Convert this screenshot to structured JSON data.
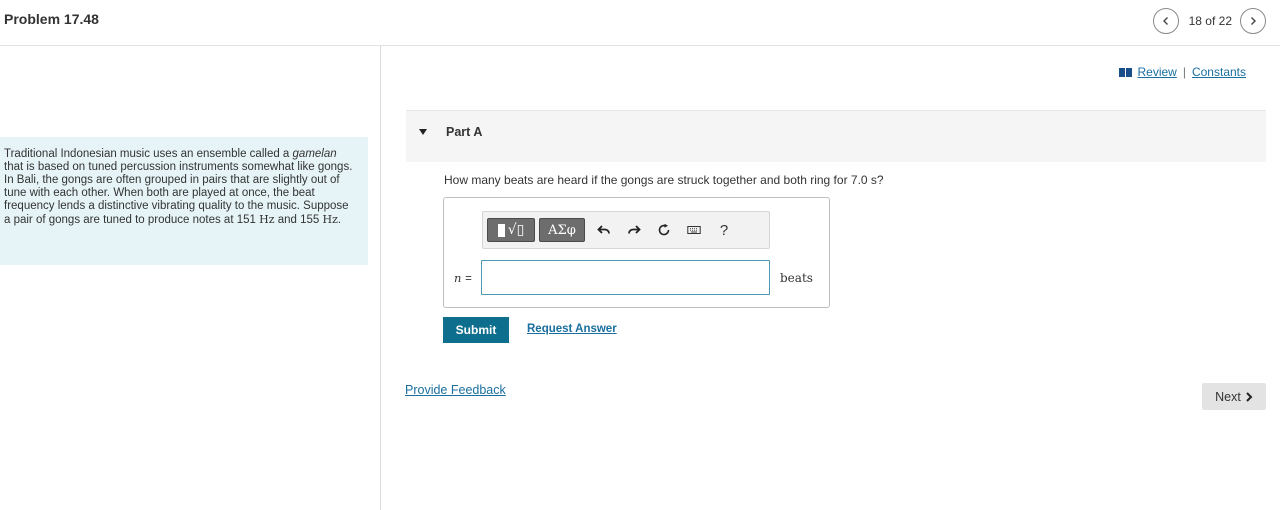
{
  "header": {
    "problem_title": "Problem 17.48",
    "pager_text": "18 of 22",
    "prev_icon": "chevron-left-icon",
    "next_icon": "chevron-right-icon"
  },
  "intro": {
    "text_before_italic": "Traditional Indonesian music uses an ensemble called a",
    "italic_word": "gamelan",
    "text_after_italic": "that is based on tuned percussion instruments somewhat like gongs. In Bali, the gongs are often grouped in pairs that are slightly out of tune with each other. When both are played at once, the beat frequency lends a distinctive vibrating quality to the music. Suppose a pair of gongs are tuned to produce notes at 151",
    "unit1": "Hz",
    "mid": "and 155",
    "unit2": "Hz",
    "end": "."
  },
  "links": {
    "review": "Review",
    "separator": "|",
    "constants": "Constants"
  },
  "part": {
    "title": "Part A",
    "question": "How many beats are heard if the gongs are struck together and both ring for 7.0 s?"
  },
  "answer": {
    "variable": "n",
    "equals": "=",
    "value": "",
    "unit": "beats",
    "toolbar": {
      "templates_label": "√▯",
      "greek_label": "ΑΣφ",
      "help_label": "?"
    }
  },
  "actions": {
    "submit": "Submit",
    "request_answer": "Request Answer",
    "feedback": "Provide Feedback",
    "next": "Next"
  },
  "colors": {
    "accent": "#0e6e8e",
    "link": "#1a6fa0",
    "intro_bg": "#e6f4f7"
  }
}
